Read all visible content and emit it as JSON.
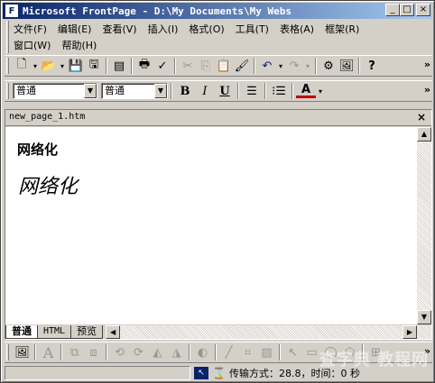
{
  "window": {
    "title": "Microsoft FrontPage - D:\\My Documents\\My Webs",
    "minimize": "_",
    "maximize": "□",
    "close": "×"
  },
  "menu": {
    "row1": [
      "文件(F)",
      "编辑(E)",
      "查看(V)",
      "插入(I)",
      "格式(O)",
      "工具(T)",
      "表格(A)",
      "框架(R)"
    ],
    "row2": [
      "窗口(W)",
      "帮助(H)"
    ]
  },
  "formatting": {
    "style": "普通",
    "font": "普通",
    "bold": "B",
    "italic": "I",
    "underline": "U",
    "font_color": "A"
  },
  "document": {
    "tab_name": "new_page_1.htm",
    "close": "×",
    "heading_bold": "网络化",
    "heading_italic": "网络化"
  },
  "view_tabs": [
    "普通",
    "HTML",
    "预览"
  ],
  "statusbar": {
    "text": "传输方式：28.8，时间：0 秒"
  },
  "watermark": "查字典 教程网"
}
